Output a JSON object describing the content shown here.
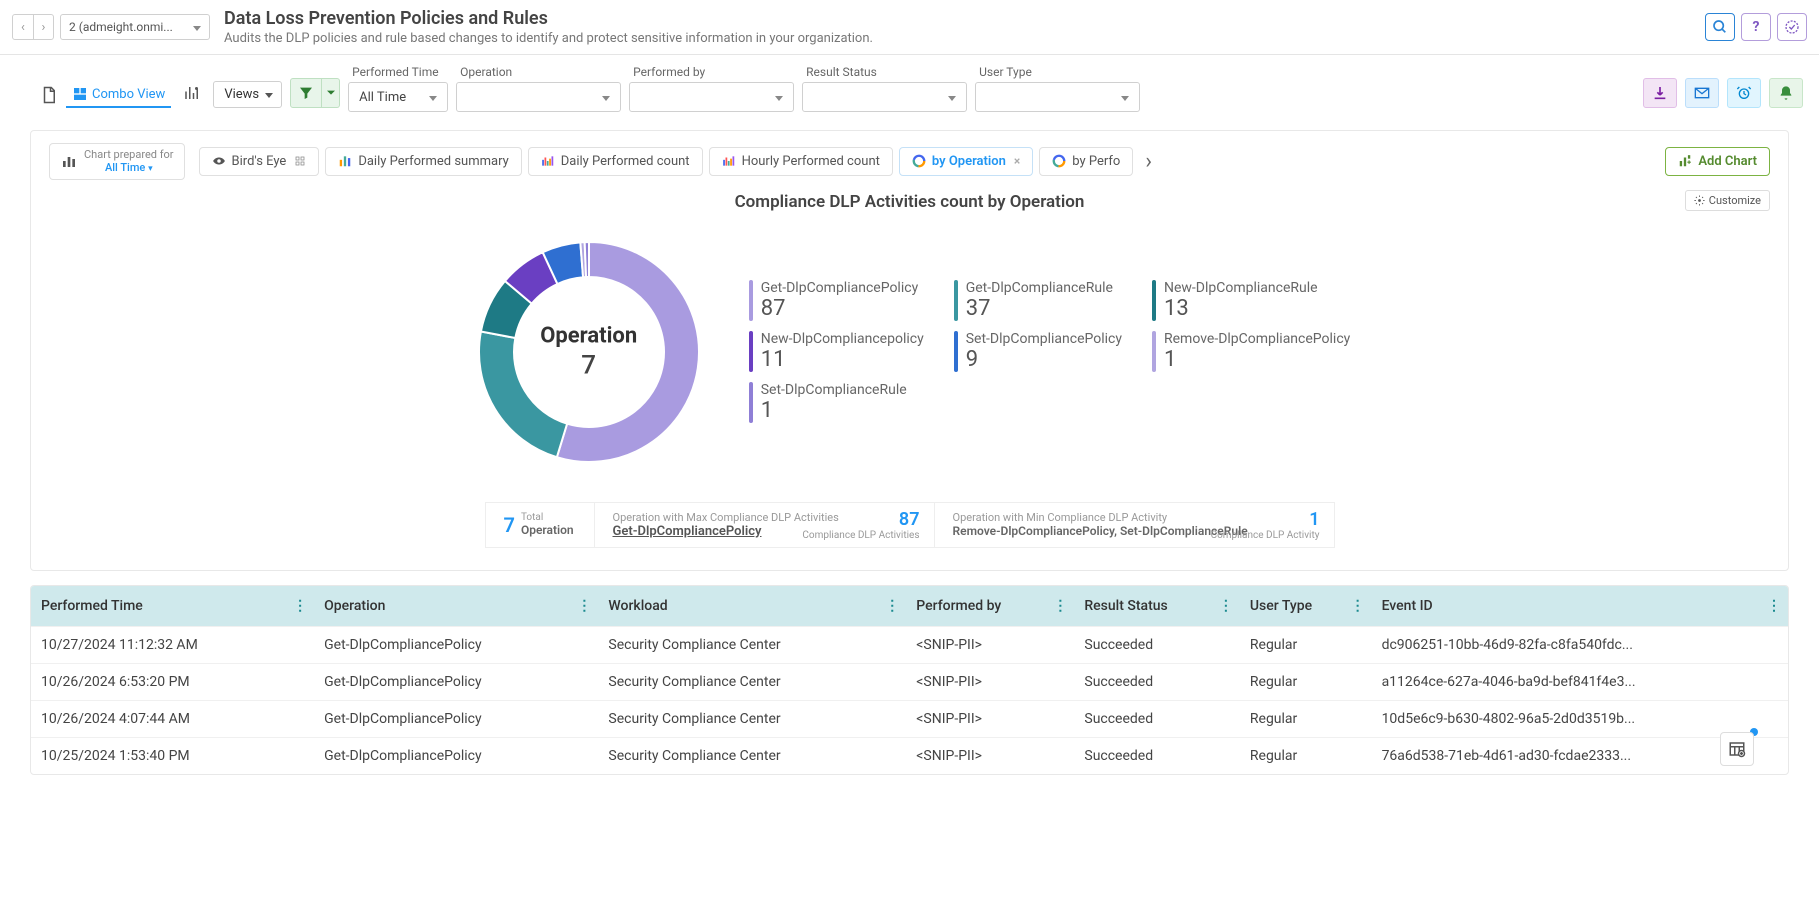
{
  "tenant": "2 (admeight.onmi...",
  "page_title": "Data Loss Prevention Policies and Rules",
  "page_subtitle": "Audits the DLP policies and rule based changes to identify and protect sensitive information in your organization.",
  "toolbar": {
    "combo_view": "Combo View",
    "views": "Views",
    "filters": {
      "performed_time": {
        "label": "Performed Time",
        "value": "All Time"
      },
      "operation": {
        "label": "Operation",
        "value": ""
      },
      "performed_by": {
        "label": "Performed by",
        "value": ""
      },
      "result_status": {
        "label": "Result Status",
        "value": ""
      },
      "user_type": {
        "label": "User Type",
        "value": ""
      }
    }
  },
  "chart_tabs": {
    "prepared_label": "Chart prepared for",
    "prepared_value": "All Time",
    "tabs": [
      "Bird's Eye",
      "Daily Performed summary",
      "Daily Performed count",
      "Hourly Performed count",
      "by Operation",
      "by Perfo"
    ],
    "active_index": 4,
    "add_chart": "Add Chart",
    "customize": "Customize"
  },
  "chart_title": "Compliance DLP Activities count by Operation",
  "chart_data": {
    "type": "pie",
    "center_label": "Operation",
    "center_value": 7,
    "series": [
      {
        "name": "Get-DlpCompliancePolicy",
        "value": 87,
        "color": "#a99be0"
      },
      {
        "name": "Get-DlpComplianceRule",
        "value": 37,
        "color": "#3a97a1"
      },
      {
        "name": "New-DlpComplianceRule",
        "value": 13,
        "color": "#1e7a85"
      },
      {
        "name": "New-DlpCompliancepolicy",
        "value": 11,
        "color": "#6a3fc2"
      },
      {
        "name": "Set-DlpCompliancePolicy",
        "value": 9,
        "color": "#2f6fd1"
      },
      {
        "name": "Remove-DlpCompliancePolicy",
        "value": 1,
        "color": "#b0a5e0"
      },
      {
        "name": "Set-DlpComplianceRule",
        "value": 1,
        "color": "#8f7fd6"
      }
    ]
  },
  "legend_rows": [
    [
      {
        "name": "Get-DlpCompliancePolicy",
        "value": 87,
        "color": "#a99be0"
      },
      {
        "name": "Get-DlpComplianceRule",
        "value": 37,
        "color": "#3a97a1"
      },
      {
        "name": "New-DlpComplianceRule",
        "value": 13,
        "color": "#1e7a85"
      }
    ],
    [
      {
        "name": "New-DlpCompliancepolicy",
        "value": 11,
        "color": "#6a3fc2"
      },
      {
        "name": "Set-DlpCompliancePolicy",
        "value": 9,
        "color": "#2f6fd1"
      },
      {
        "name": "Remove-DlpCompliancePolicy",
        "value": 1,
        "color": "#b0a5e0"
      }
    ],
    [
      {
        "name": "Set-DlpComplianceRule",
        "value": 1,
        "color": "#8f7fd6"
      }
    ]
  ],
  "summary": {
    "total_num": 7,
    "total_small": "Total",
    "total_label": "Operation",
    "max_label": "Operation with Max Compliance DLP Activities",
    "max_op": "Get-DlpCompliancePolicy",
    "max_val": 87,
    "max_val_label": "Compliance DLP Activities",
    "min_label": "Operation with Min Compliance DLP Activity",
    "min_op": "Remove-DlpCompliancePolicy, Set-DlpComplianceRule",
    "min_val": 1,
    "min_val_label": "Compliance DLP Activity"
  },
  "table": {
    "columns": [
      "Performed Time",
      "Operation",
      "Workload",
      "Performed by",
      "Result Status",
      "User Type",
      "Event ID"
    ],
    "rows": [
      [
        "10/27/2024 11:12:32 AM",
        "Get-DlpCompliancePolicy",
        "Security Compliance Center",
        "<SNIP-PII>",
        "Succeeded",
        "Regular",
        "dc906251-10bb-46d9-82fa-c8fa540fdc..."
      ],
      [
        "10/26/2024 6:53:20 PM",
        "Get-DlpCompliancePolicy",
        "Security Compliance Center",
        "<SNIP-PII>",
        "Succeeded",
        "Regular",
        "a11264ce-627a-4046-ba9d-bef841f4e3..."
      ],
      [
        "10/26/2024 4:07:44 AM",
        "Get-DlpCompliancePolicy",
        "Security Compliance Center",
        "<SNIP-PII>",
        "Succeeded",
        "Regular",
        "10d5e6c9-b630-4802-96a5-2d0d3519b..."
      ],
      [
        "10/25/2024 1:53:40 PM",
        "Get-DlpCompliancePolicy",
        "Security Compliance Center",
        "<SNIP-PII>",
        "Succeeded",
        "Regular",
        "76a6d538-71eb-4d61-ad30-fcdae2333..."
      ]
    ]
  }
}
